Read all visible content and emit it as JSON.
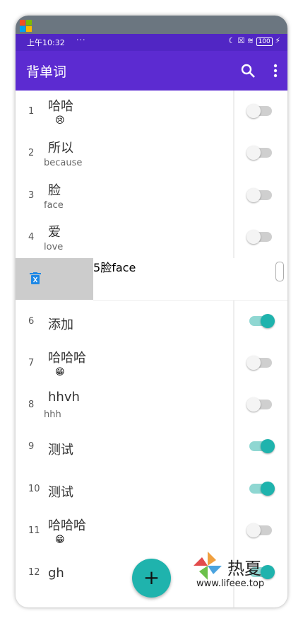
{
  "status": {
    "time": "上午10:32",
    "dots": "···",
    "battery": "100"
  },
  "app": {
    "title": "背单词"
  },
  "rows": [
    {
      "num": "1",
      "word": "哈哈",
      "sub": "",
      "emoji": "😢",
      "toggle": "off"
    },
    {
      "num": "2",
      "word": "所以",
      "sub": "because",
      "emoji": "",
      "toggle": "off"
    },
    {
      "num": "3",
      "word": "脸",
      "sub": "face",
      "emoji": "",
      "toggle": "off"
    },
    {
      "num": "4",
      "word": "爱",
      "sub": "love",
      "emoji": "",
      "toggle": "off"
    },
    {
      "num": "5",
      "word": "脸",
      "sub": "face",
      "emoji": "",
      "toggle": "swiped"
    },
    {
      "num": "6",
      "word": "添加",
      "sub": "",
      "emoji": "",
      "toggle": "on"
    },
    {
      "num": "7",
      "word": "哈哈哈",
      "sub": "",
      "emoji": "😁",
      "toggle": "off"
    },
    {
      "num": "8",
      "word": "hhvh",
      "sub": "hhh",
      "emoji": "",
      "toggle": "off"
    },
    {
      "num": "9",
      "word": "测试",
      "sub": "",
      "emoji": "",
      "toggle": "on"
    },
    {
      "num": "10",
      "word": "测试",
      "sub": "",
      "emoji": "",
      "toggle": "on"
    },
    {
      "num": "11",
      "word": "哈哈哈",
      "sub": "",
      "emoji": "😁",
      "toggle": "off"
    },
    {
      "num": "12",
      "word": "gh",
      "sub": "",
      "emoji": "",
      "toggle": "on"
    }
  ],
  "fab": {
    "label": "+"
  },
  "watermark": {
    "title": "热夏",
    "url": "www.lifeee.top"
  }
}
